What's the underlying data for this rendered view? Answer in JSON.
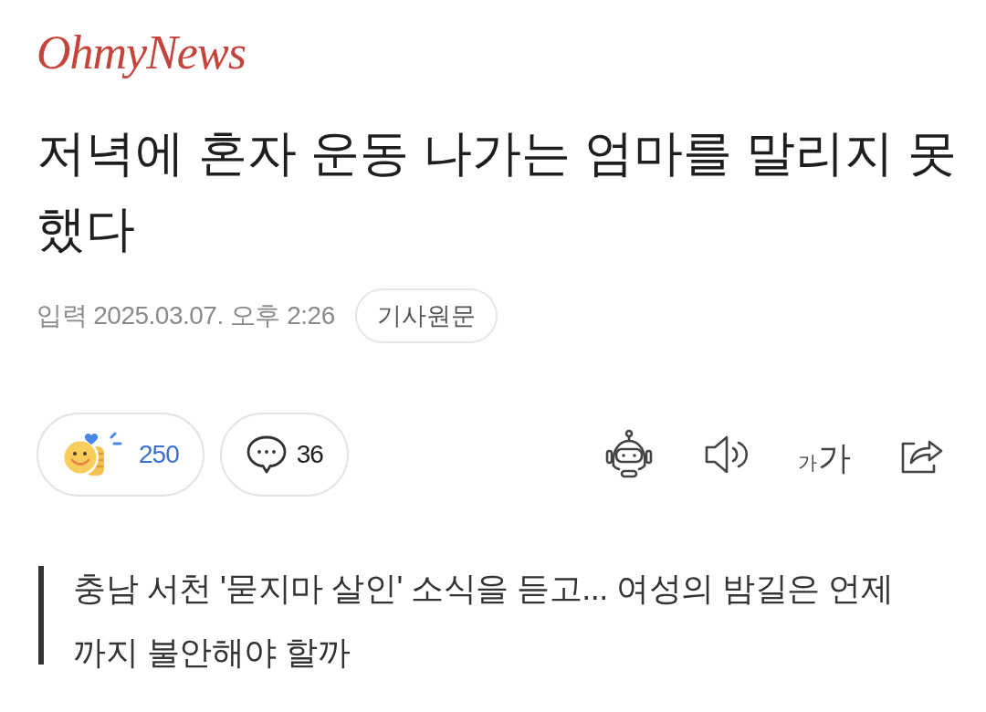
{
  "logo": {
    "text": "OhmyNews"
  },
  "headline": "저녁에 혼자 운동 나가는 엄마를 말리지 못했다",
  "meta": {
    "published": "입력 2025.03.07. 오후 2:26",
    "original_button": "기사원문"
  },
  "reactions": [
    {
      "kind": "like",
      "count": "250"
    },
    {
      "kind": "comment",
      "count": "36"
    }
  ],
  "tools": [
    {
      "kind": "robot"
    },
    {
      "kind": "listen"
    },
    {
      "kind": "font_size",
      "small": "가",
      "large": "가"
    },
    {
      "kind": "share"
    }
  ],
  "subtitle": "충남 서천 '묻지마 살인' 소식을 듣고... 여성의 밤길은 언제까지 불안해야 할까"
}
